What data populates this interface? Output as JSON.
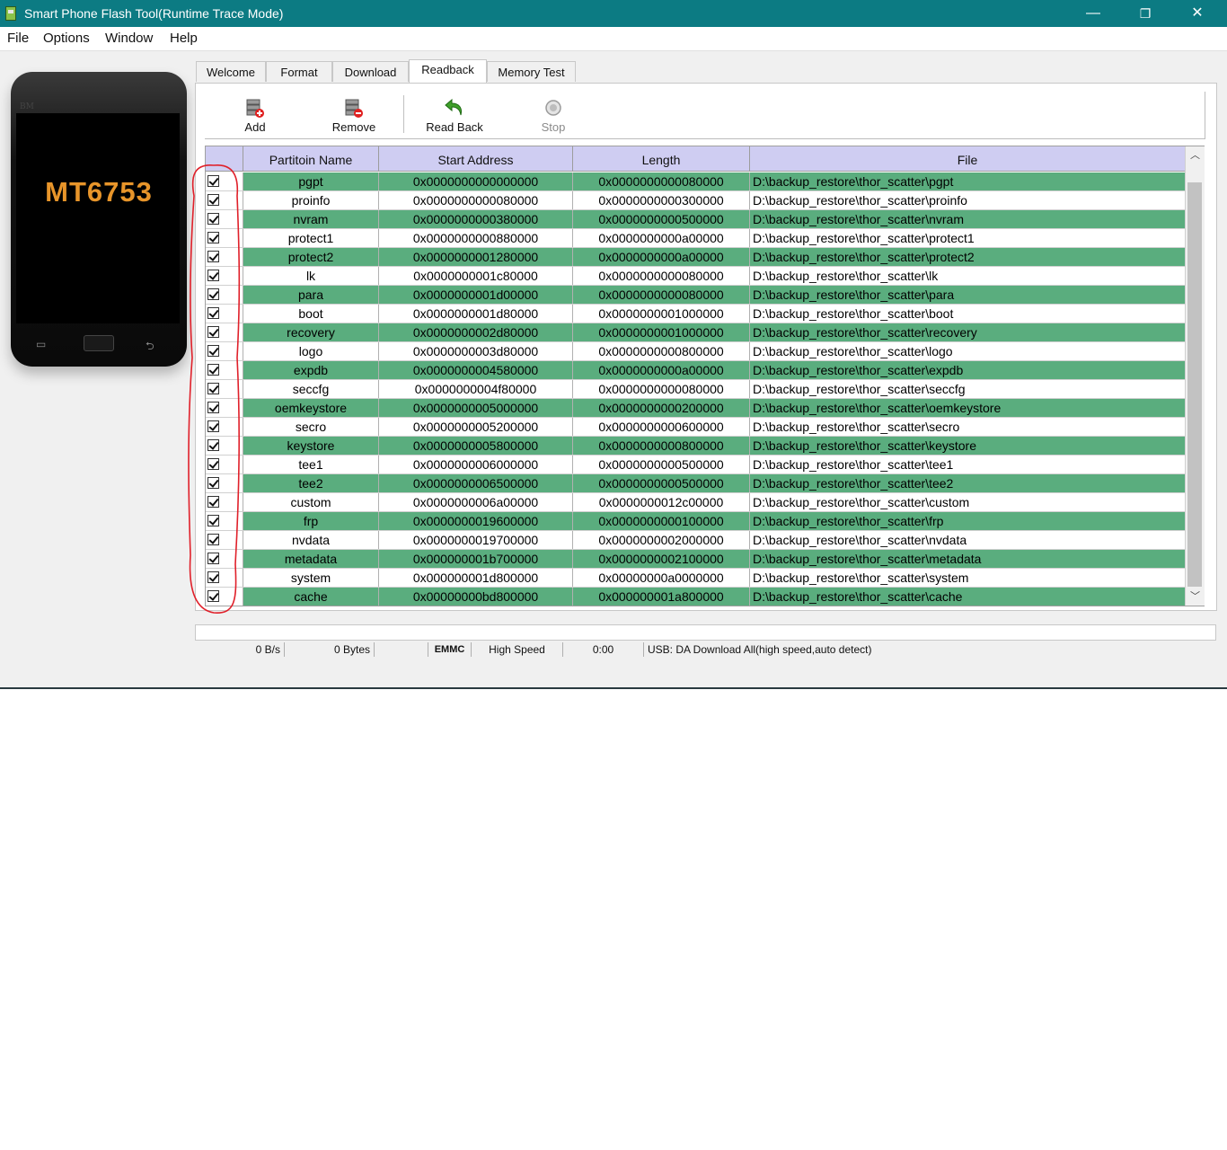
{
  "window": {
    "title": "Smart Phone Flash Tool(Runtime Trace Mode)",
    "controls": {
      "minimize": "—",
      "maximize": "❐",
      "close": "✕"
    },
    "accent_color": "#0c7b83"
  },
  "menu": [
    "File",
    "Options",
    "Window",
    "Help"
  ],
  "phone": {
    "brand": "BM",
    "model": "MT6753"
  },
  "tabs": [
    {
      "label": "Welcome",
      "active": false
    },
    {
      "label": "Format",
      "active": false
    },
    {
      "label": "Download",
      "active": false
    },
    {
      "label": "Readback",
      "active": true
    },
    {
      "label": "Memory Test",
      "active": false
    }
  ],
  "toolbar": {
    "add": {
      "label": "Add",
      "icon": "add-database-icon"
    },
    "remove": {
      "label": "Remove",
      "icon": "remove-database-icon"
    },
    "read_back": {
      "label": "Read Back",
      "icon": "green-back-arrow-icon"
    },
    "stop": {
      "label": "Stop",
      "icon": "stop-icon"
    }
  },
  "table": {
    "headers": [
      "Partitoin Name",
      "Start Address",
      "Length",
      "File"
    ],
    "row_color_green": "#5aad7e",
    "header_color": "#cfcdf2",
    "rows": [
      {
        "name": "pgpt",
        "start": "0x0000000000000000",
        "length": "0x0000000000080000",
        "file": "D:\\backup_restore\\thor_scatter\\pgpt",
        "checked": true
      },
      {
        "name": "proinfo",
        "start": "0x0000000000080000",
        "length": "0x0000000000300000",
        "file": "D:\\backup_restore\\thor_scatter\\proinfo",
        "checked": true
      },
      {
        "name": "nvram",
        "start": "0x0000000000380000",
        "length": "0x0000000000500000",
        "file": "D:\\backup_restore\\thor_scatter\\nvram",
        "checked": true
      },
      {
        "name": "protect1",
        "start": "0x0000000000880000",
        "length": "0x0000000000a00000",
        "file": "D:\\backup_restore\\thor_scatter\\protect1",
        "checked": true
      },
      {
        "name": "protect2",
        "start": "0x0000000001280000",
        "length": "0x0000000000a00000",
        "file": "D:\\backup_restore\\thor_scatter\\protect2",
        "checked": true
      },
      {
        "name": "lk",
        "start": "0x0000000001c80000",
        "length": "0x0000000000080000",
        "file": "D:\\backup_restore\\thor_scatter\\lk",
        "checked": true
      },
      {
        "name": "para",
        "start": "0x0000000001d00000",
        "length": "0x0000000000080000",
        "file": "D:\\backup_restore\\thor_scatter\\para",
        "checked": true
      },
      {
        "name": "boot",
        "start": "0x0000000001d80000",
        "length": "0x0000000001000000",
        "file": "D:\\backup_restore\\thor_scatter\\boot",
        "checked": true
      },
      {
        "name": "recovery",
        "start": "0x0000000002d80000",
        "length": "0x0000000001000000",
        "file": "D:\\backup_restore\\thor_scatter\\recovery",
        "checked": true
      },
      {
        "name": "logo",
        "start": "0x0000000003d80000",
        "length": "0x0000000000800000",
        "file": "D:\\backup_restore\\thor_scatter\\logo",
        "checked": true
      },
      {
        "name": "expdb",
        "start": "0x0000000004580000",
        "length": "0x0000000000a00000",
        "file": "D:\\backup_restore\\thor_scatter\\expdb",
        "checked": true
      },
      {
        "name": "seccfg",
        "start": "0x0000000004f80000",
        "length": "0x0000000000080000",
        "file": "D:\\backup_restore\\thor_scatter\\seccfg",
        "checked": true
      },
      {
        "name": "oemkeystore",
        "start": "0x0000000005000000",
        "length": "0x0000000000200000",
        "file": "D:\\backup_restore\\thor_scatter\\oemkeystore",
        "checked": true
      },
      {
        "name": "secro",
        "start": "0x0000000005200000",
        "length": "0x0000000000600000",
        "file": "D:\\backup_restore\\thor_scatter\\secro",
        "checked": true
      },
      {
        "name": "keystore",
        "start": "0x0000000005800000",
        "length": "0x0000000000800000",
        "file": "D:\\backup_restore\\thor_scatter\\keystore",
        "checked": true
      },
      {
        "name": "tee1",
        "start": "0x0000000006000000",
        "length": "0x0000000000500000",
        "file": "D:\\backup_restore\\thor_scatter\\tee1",
        "checked": true
      },
      {
        "name": "tee2",
        "start": "0x0000000006500000",
        "length": "0x0000000000500000",
        "file": "D:\\backup_restore\\thor_scatter\\tee2",
        "checked": true
      },
      {
        "name": "custom",
        "start": "0x0000000006a00000",
        "length": "0x0000000012c00000",
        "file": "D:\\backup_restore\\thor_scatter\\custom",
        "checked": true
      },
      {
        "name": "frp",
        "start": "0x0000000019600000",
        "length": "0x0000000000100000",
        "file": "D:\\backup_restore\\thor_scatter\\frp",
        "checked": true
      },
      {
        "name": "nvdata",
        "start": "0x0000000019700000",
        "length": "0x0000000002000000",
        "file": "D:\\backup_restore\\thor_scatter\\nvdata",
        "checked": true
      },
      {
        "name": "metadata",
        "start": "0x000000001b700000",
        "length": "0x0000000002100000",
        "file": "D:\\backup_restore\\thor_scatter\\metadata",
        "checked": true
      },
      {
        "name": "system",
        "start": "0x000000001d800000",
        "length": "0x00000000a0000000",
        "file": "D:\\backup_restore\\thor_scatter\\system",
        "checked": true
      },
      {
        "name": "cache",
        "start": "0x00000000bd800000",
        "length": "0x000000001a800000",
        "file": "D:\\backup_restore\\thor_scatter\\cache",
        "checked": true
      }
    ]
  },
  "status": {
    "speed": "0 B/s",
    "bytes": "0 Bytes",
    "storage": "EMMC",
    "mode": "High Speed",
    "time": "0:00",
    "message": "USB: DA Download All(high speed,auto detect)"
  },
  "annotation_color": "#e0202a"
}
